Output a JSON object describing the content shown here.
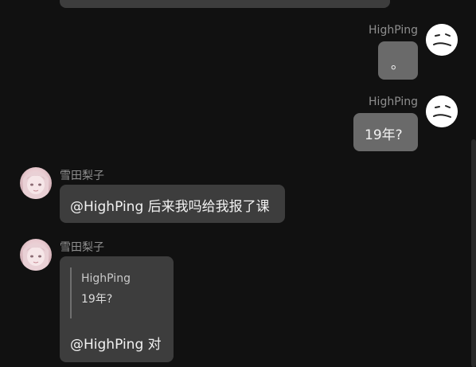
{
  "messages": [
    {
      "sender": "HighPing",
      "side": "right",
      "avatar": "neutral-face",
      "text": "。"
    },
    {
      "sender": "HighPing",
      "side": "right",
      "avatar": "neutral-face",
      "text": "19年?"
    },
    {
      "sender": "雪田梨子",
      "side": "left",
      "avatar": "anime-girl",
      "text": "@HighPing 后来我吗给我报了课"
    },
    {
      "sender": "雪田梨子",
      "side": "left",
      "avatar": "anime-girl",
      "quote": {
        "sender": "HighPing",
        "text": "19年?"
      },
      "text": "@HighPing 对"
    }
  ],
  "colors": {
    "background": "#111111",
    "bubble_self": "#6a6a6a",
    "bubble_other": "#3d3d3d",
    "name_text": "#8f8f8f",
    "message_text": "#f2f2f2"
  }
}
